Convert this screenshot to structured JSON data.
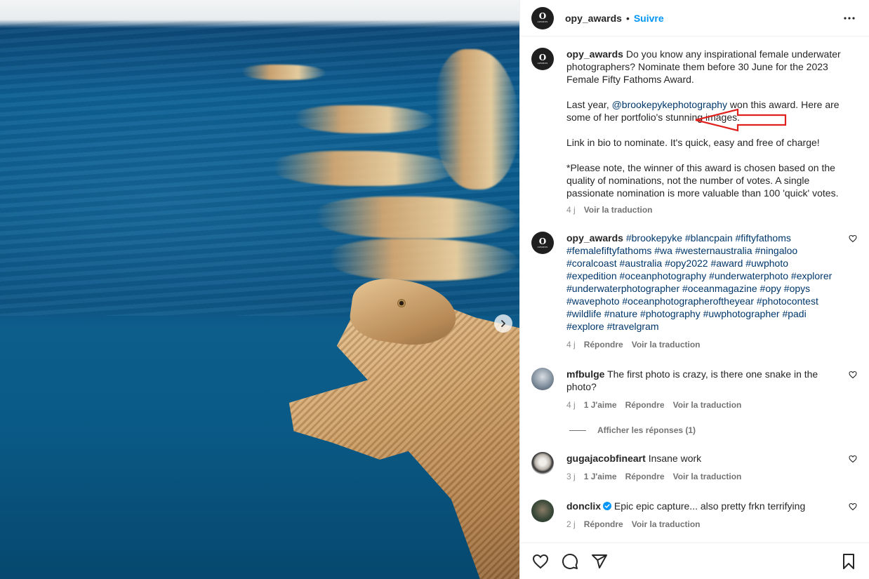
{
  "post": {
    "author": "opy_awards",
    "separator": "•",
    "follow_label": "Suivre",
    "caption": {
      "line1": "Do you know any inspirational female underwater photographers? Nominate them before 30 June for the 2023 Female Fifty Fathoms Award.",
      "para2_prefix": "Last year, ",
      "mention": "@brookepykephotography",
      "para2_suffix": " won this award. Here are some of her portfolio's stunning images.",
      "para3": "Link in bio to nominate. It's quick, easy and free of charge!",
      "para4": "*Please note, the winner of this award is chosen based on the quality of nominations, not the number of votes. A single passionate nomination is more valuable than 100 'quick' votes.",
      "time": "4 j",
      "translate": "Voir la traduction"
    }
  },
  "comments": [
    {
      "user": "opy_awards",
      "text": "#brookepyke #blancpain #fiftyfathoms #femalefiftyfathoms #wa #westernaustralia #ningaloo #coralcoast #australia #opy2022 #award #uwphoto #expedition #oceanphotography #underwaterphoto #explorer #underwaterphotographer #oceanmagazine #opy #opys #wavephoto #oceanphotographeroftheyear #photocontest #wildlife #nature #photography #uwphotographer #padi #explore #travelgram",
      "time": "4 j",
      "reply": "Répondre",
      "translate": "Voir la traduction"
    },
    {
      "user": "mfbulge",
      "text": "The first photo is crazy, is there one snake in the photo?",
      "time": "4 j",
      "likes": "1 J'aime",
      "reply": "Répondre",
      "translate": "Voir la traduction",
      "show_replies": "Afficher les réponses (1)"
    },
    {
      "user": "gugajacobfineart",
      "text": "Insane work",
      "time": "3 j",
      "likes": "1 J'aime",
      "reply": "Répondre",
      "translate": "Voir la traduction"
    },
    {
      "user": "donclix",
      "text": "Epic epic capture... also pretty frkn terrifying",
      "time": "2 j",
      "reply": "Répondre",
      "translate": "Voir la traduction"
    }
  ],
  "icons": {
    "more": "more-horizontal-icon",
    "like": "heart-icon",
    "comment": "comment-icon",
    "share": "paper-plane-icon",
    "save": "bookmark-icon",
    "next": "chevron-right-icon",
    "verified": "verified-badge-icon"
  },
  "colors": {
    "link": "#00376b",
    "follow": "#0095f6",
    "annotation_arrow": "#e0201c",
    "verified": "#0095f6"
  }
}
